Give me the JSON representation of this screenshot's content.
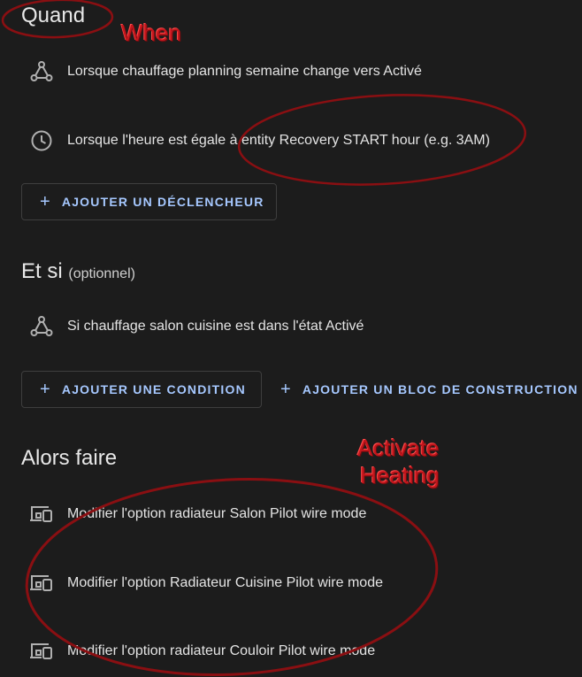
{
  "when": {
    "title": "Quand",
    "triggers": [
      {
        "icon": "automation-nodes-icon",
        "label": "Lorsque chauffage planning semaine change vers Activé"
      },
      {
        "icon": "clock-icon",
        "label": "Lorsque l'heure est égale à entity Recovery START hour (e.g. 3AM)"
      }
    ],
    "add_trigger_label": "AJOUTER UN DÉCLENCHEUR"
  },
  "and_if": {
    "title": "Et si",
    "optional_label": "(optionnel)",
    "conditions": [
      {
        "icon": "automation-nodes-icon",
        "label": "Si chauffage salon cuisine est dans l'état Activé"
      }
    ],
    "add_condition_label": "AJOUTER UNE CONDITION",
    "add_block_label": "AJOUTER UN BLOC DE CONSTRUCTION"
  },
  "then_do": {
    "title": "Alors faire",
    "actions": [
      {
        "icon": "device-icon",
        "label": "Modifier l'option radiateur Salon Pilot wire mode"
      },
      {
        "icon": "device-icon",
        "label": "Modifier l'option Radiateur Cuisine Pilot wire mode"
      },
      {
        "icon": "device-icon",
        "label": "Modifier l'option radiateur Couloir Pilot wire mode"
      }
    ]
  },
  "annotations": {
    "when_label": "When",
    "activate_label_line1": "Activate",
    "activate_label_line2": "Heating",
    "color": "#c4161c"
  },
  "colors": {
    "background": "#1c1c1c",
    "accent": "#a6c8ff",
    "icon": "#b0b0b0"
  }
}
